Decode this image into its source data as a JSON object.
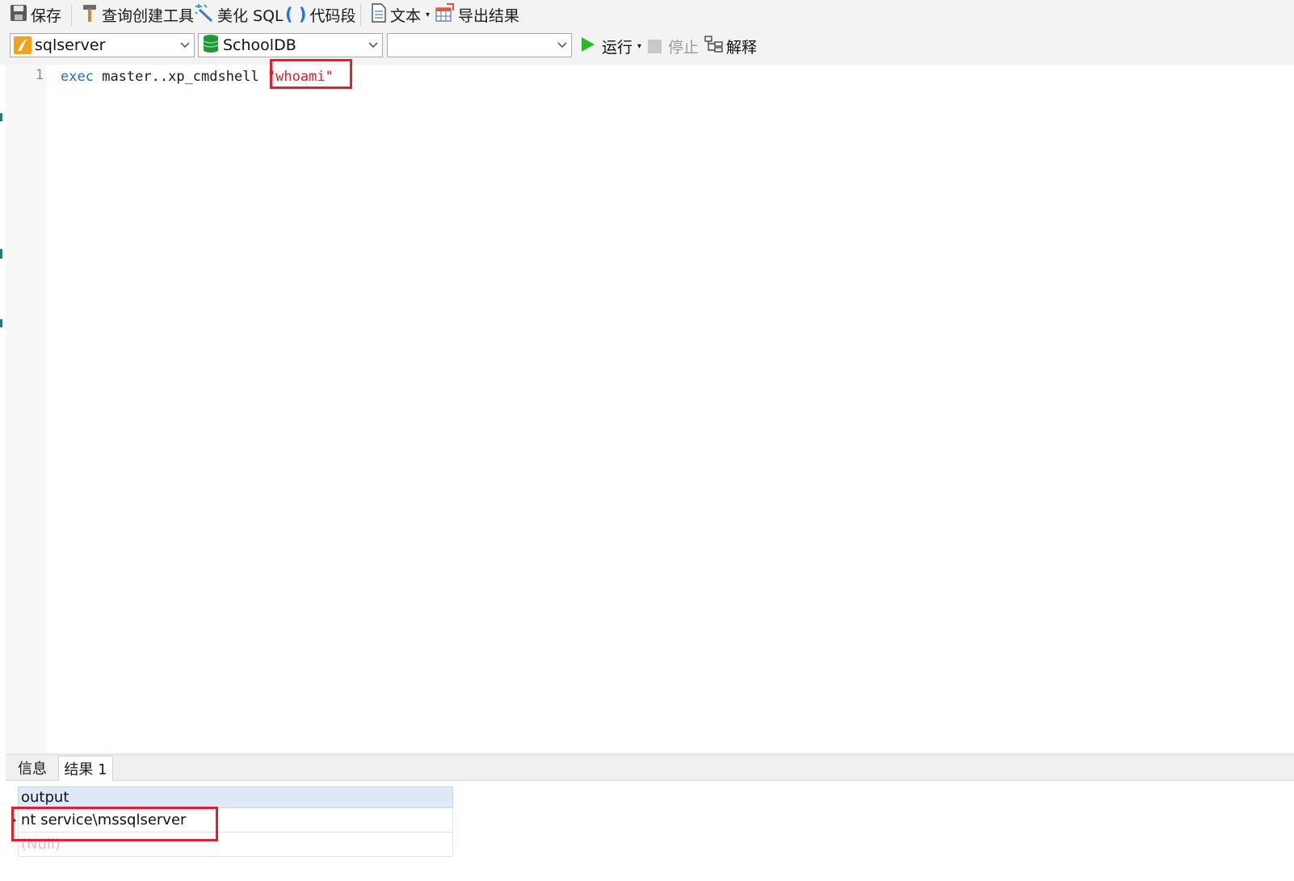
{
  "toolbar": {
    "save_label": "保存",
    "query_builder_label": "查询创建工具",
    "beautify_label": "美化 SQL",
    "snippet_label": "代码段",
    "text_label": "文本",
    "export_label": "导出结果",
    "icons": {
      "save": "floppy-disk-icon",
      "query_builder": "hammer-icon",
      "beautify": "magic-wand-icon",
      "snippet": "parentheses-icon",
      "text": "document-icon",
      "export": "export-table-icon"
    }
  },
  "connection_bar": {
    "connection_value": "sqlserver",
    "database_value": "SchoolDB",
    "schema_value": "",
    "run_label": "运行",
    "stop_label": "停止",
    "explain_label": "解释"
  },
  "editor": {
    "line_number": "1",
    "keyword": "exec",
    "identifier": "master..xp_cmdshell",
    "string_literal": "\"whoami\""
  },
  "results": {
    "tabs": [
      {
        "label": "信息"
      },
      {
        "label": "结果 1"
      }
    ],
    "active_tab": "结果 1",
    "column_header": "output",
    "rows": [
      "nt service\\mssqlserver",
      "(Null)"
    ]
  },
  "colors": {
    "highlight_box": "#e3202a",
    "keyword": "#1f6fd1",
    "string": "#e01b24",
    "run_icon": "#2bb82b",
    "db_icon": "#1d9a37",
    "grid_header": "#dde9f6"
  }
}
